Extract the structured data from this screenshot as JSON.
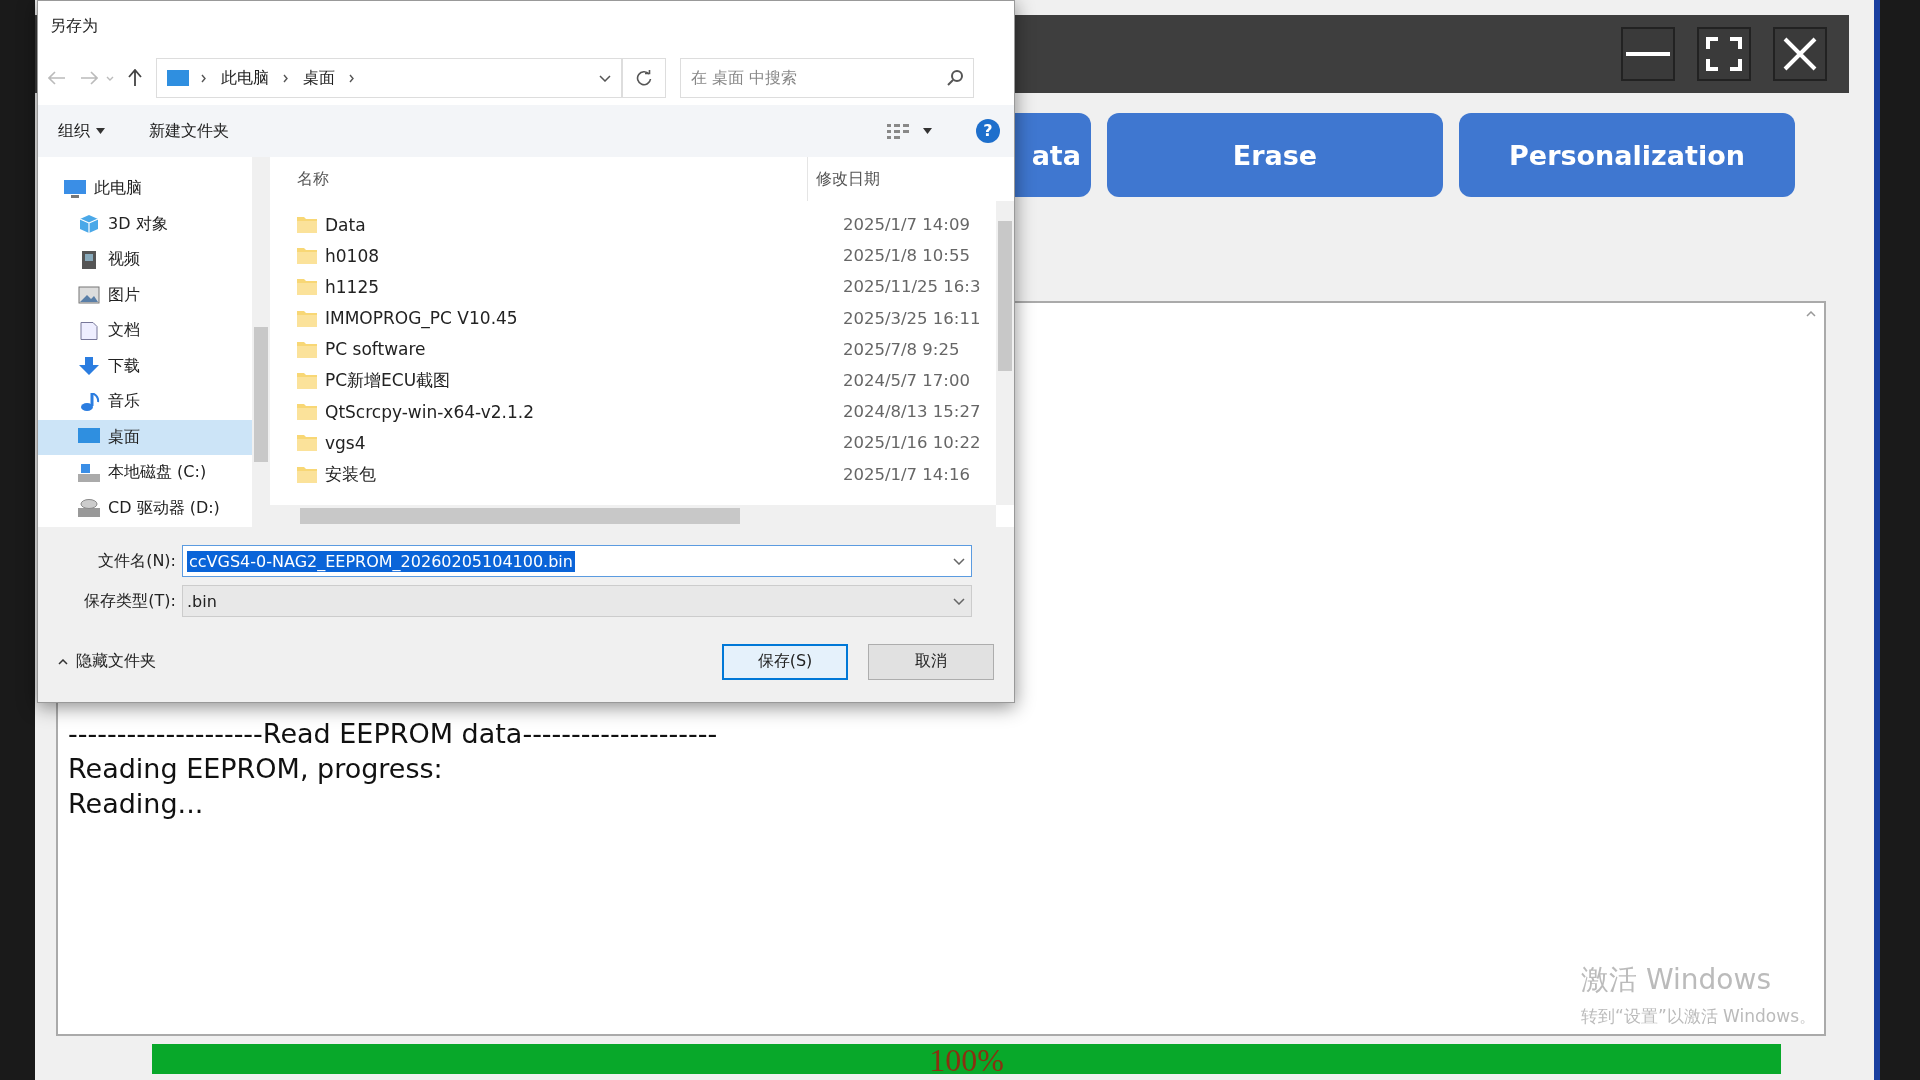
{
  "app": {
    "action_buttons": [
      {
        "label": "ata"
      },
      {
        "label": "Erase"
      },
      {
        "label": "Personalization"
      }
    ],
    "log": {
      "lines": [
        "--------------------Read EEPROM data--------------------",
        "Reading EEPROM, progress:",
        "Reading..."
      ]
    },
    "progress": {
      "level": 1,
      "label": "100%"
    }
  },
  "dialog": {
    "title": "另存为",
    "breadcrumb": [
      "此电脑",
      "桌面"
    ],
    "search": {
      "placeholder": "在 桌面 中搜索"
    },
    "toolbar": [
      "组织",
      "新建文件夹"
    ],
    "help_button": "?",
    "sidebar": {
      "items": [
        {
          "label": "此电脑",
          "kind": "pc",
          "selected": false,
          "children": [
            {
              "label": "3D 对象",
              "kind": "cube",
              "selected": false
            },
            {
              "label": "视频",
              "kind": "video",
              "selected": false
            },
            {
              "label": "图片",
              "kind": "picture",
              "selected": false
            },
            {
              "label": "文档",
              "kind": "document",
              "selected": false
            },
            {
              "label": "下载",
              "kind": "download",
              "selected": false
            },
            {
              "label": "音乐",
              "kind": "music",
              "selected": false
            },
            {
              "label": "桌面",
              "kind": "desktop",
              "selected": true
            },
            {
              "label": "本地磁盘 (C:)",
              "kind": "drive",
              "selected": false
            },
            {
              "label": "CD 驱动器 (D:)",
              "kind": "cd",
              "selected": false
            }
          ]
        }
      ]
    },
    "columns": [
      "名称",
      "修改日期"
    ],
    "files": [
      {
        "name": "Data",
        "modified": "2025/1/7 14:09"
      },
      {
        "name": "h0108",
        "modified": "2025/1/8 10:55"
      },
      {
        "name": "h1125",
        "modified": "2025/11/25 16:3"
      },
      {
        "name": "IMMOPROG_PC  V10.45",
        "modified": "2025/3/25 16:11"
      },
      {
        "name": "PC software",
        "modified": "2025/7/8 9:25"
      },
      {
        "name": "PC新增ECU截图",
        "modified": "2024/5/7 17:00"
      },
      {
        "name": "QtScrcpy-win-x64-v2.1.2",
        "modified": "2024/8/13 15:27"
      },
      {
        "name": "vgs4",
        "modified": "2025/1/16 10:22"
      },
      {
        "name": "安装包",
        "modified": "2025/1/7 14:16"
      }
    ],
    "filename": {
      "label": "文件名(N):",
      "value": "ccVGS4-0-NAG2_EEPROM_20260205104100.bin"
    },
    "filetype": {
      "label": "保存类型(T):",
      "value": ".bin"
    },
    "hide_folders": "隐藏文件夹",
    "buttons": [
      {
        "label": "保存(S)",
        "kind": "primary"
      },
      {
        "label": "取消",
        "kind": "normal"
      }
    ]
  },
  "os_watermark": {
    "title": "激活 Windows",
    "subtitle": "转到“设置”以激活 Windows。"
  }
}
